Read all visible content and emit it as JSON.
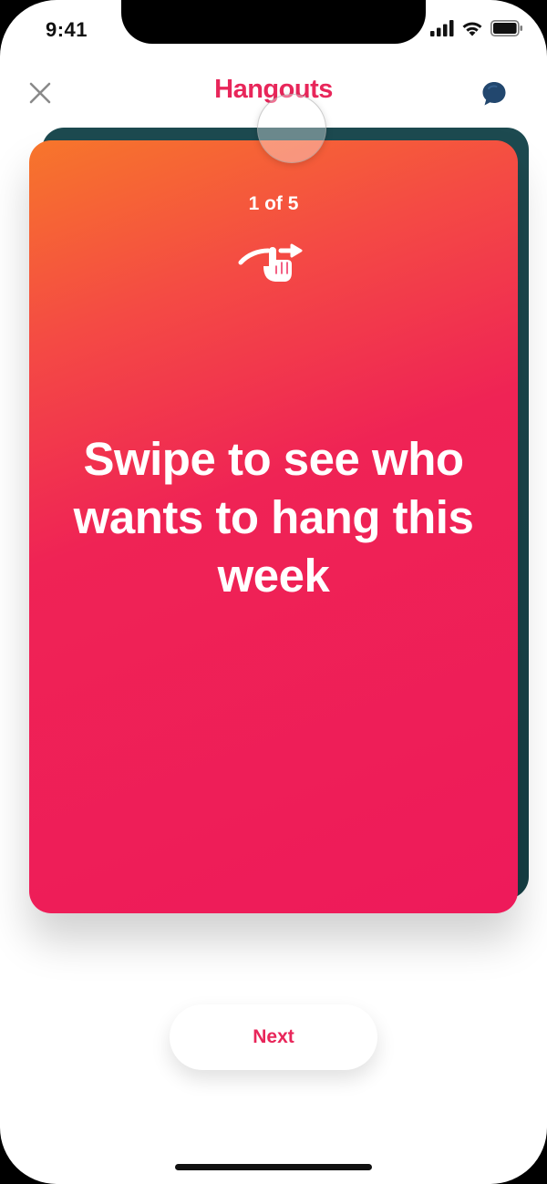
{
  "status_bar": {
    "time": "9:41",
    "icons": [
      "signal-icon",
      "wifi-icon",
      "battery-icon"
    ]
  },
  "header": {
    "title": "Hangouts",
    "left_icon": "close-icon",
    "right_icon": "chat-bubble-icon"
  },
  "card": {
    "counter": "1 of 5",
    "icon": "swipe-gesture-icon",
    "headline": "Swipe to see who wants to hang this week"
  },
  "footer": {
    "next_label": "Next"
  },
  "colors": {
    "accent": "#e8265a",
    "card_gradient_start": "#f7762b",
    "card_gradient_end": "#ee1a5a",
    "back_card": "#1d4a50"
  }
}
